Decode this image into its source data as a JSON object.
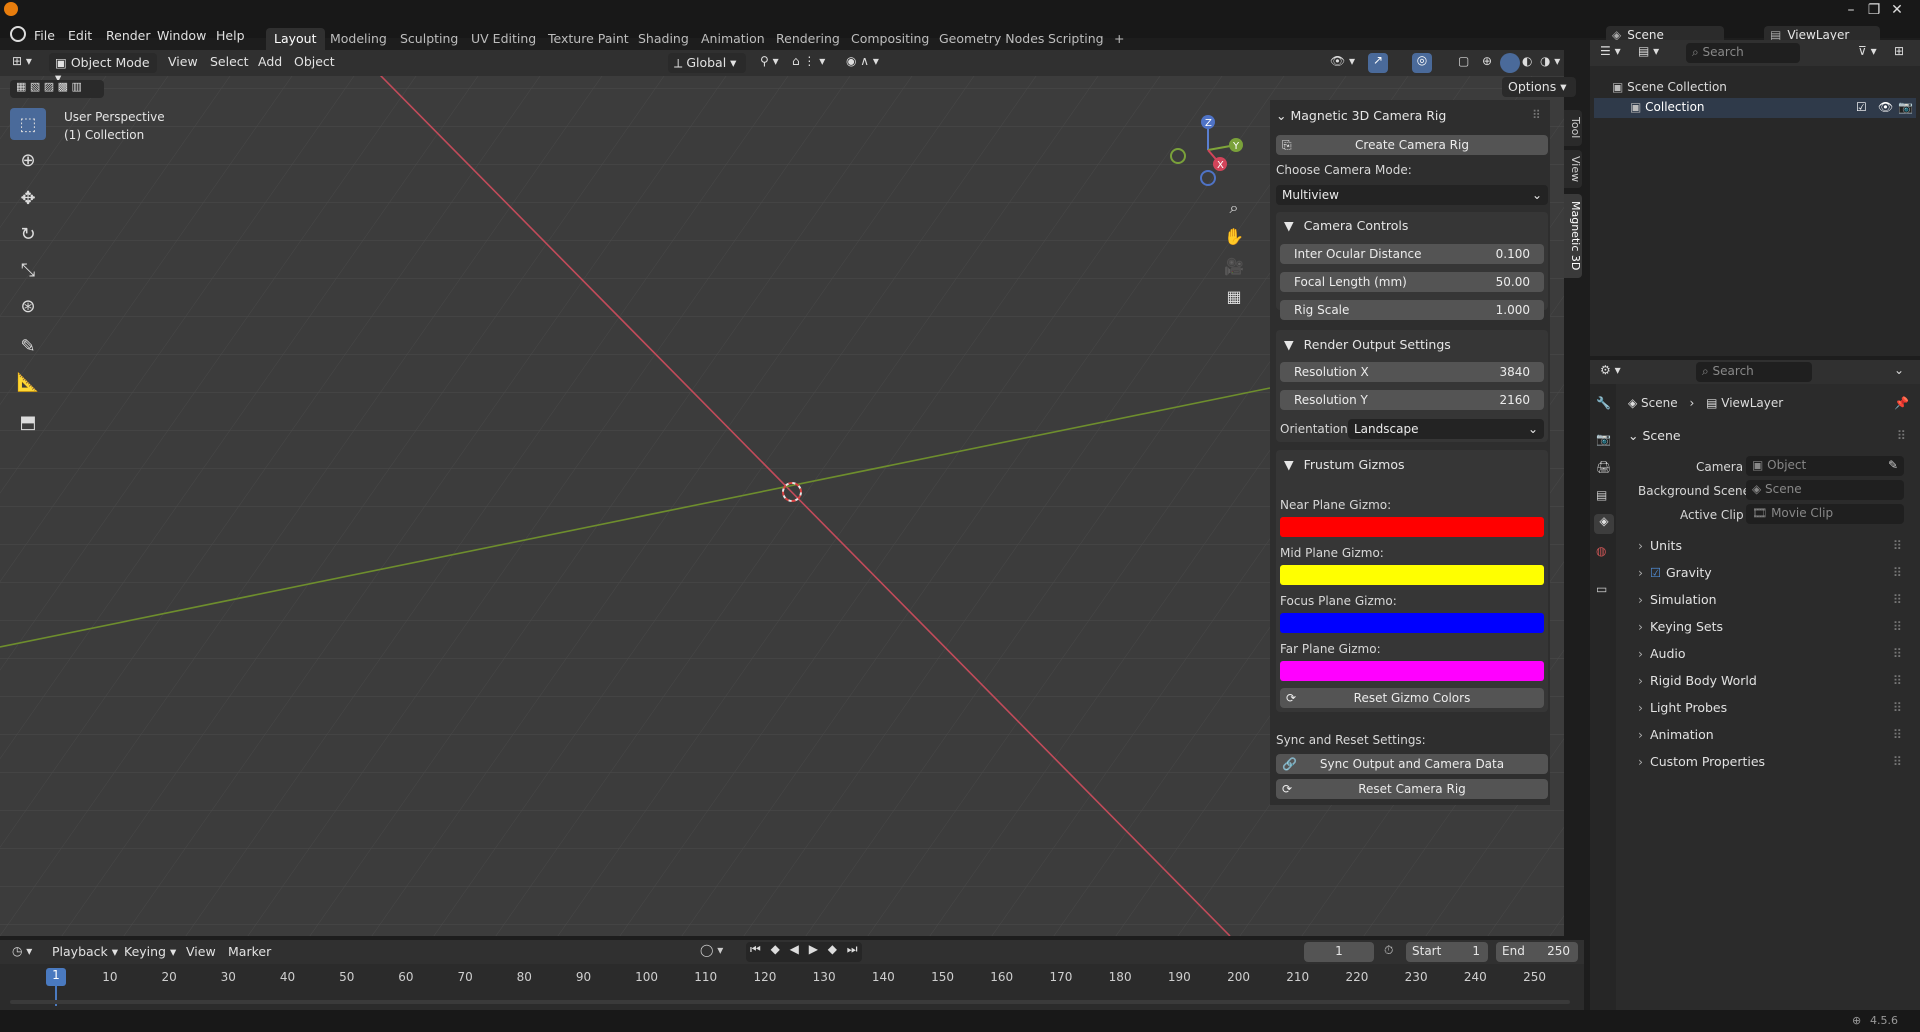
{
  "menubar": {
    "items": [
      "File",
      "Edit",
      "Render",
      "Window",
      "Help"
    ],
    "workspaces": [
      "Layout",
      "Modeling",
      "Sculpting",
      "UV Editing",
      "Texture Paint",
      "Shading",
      "Animation",
      "Rendering",
      "Compositing",
      "Geometry Nodes",
      "Scripting"
    ],
    "add_tab": "+",
    "scene": "Scene",
    "view_layer": "ViewLayer"
  },
  "viewport_header": {
    "mode": "Object Mode",
    "menus": [
      "View",
      "Select",
      "Add",
      "Object"
    ],
    "orientation": "Global",
    "options": "Options"
  },
  "viewport": {
    "perspective": "User Perspective",
    "collection": "(1) Collection",
    "axes": {
      "x": "X",
      "y": "Y",
      "z": "Z"
    }
  },
  "npanel": {
    "title": "Magnetic 3D Camera Rig",
    "create_button": "Create Camera Rig",
    "choose_mode_label": "Choose Camera Mode:",
    "mode_value": "Multiview",
    "camera_controls": {
      "title": "Camera Controls",
      "fields": [
        {
          "label": "Inter Ocular Distance",
          "value": "0.100"
        },
        {
          "label": "Focal Length (mm)",
          "value": "50.00"
        },
        {
          "label": "Rig Scale",
          "value": "1.000"
        }
      ]
    },
    "render_output": {
      "title": "Render Output Settings",
      "fields": [
        {
          "label": "Resolution X",
          "value": "3840"
        },
        {
          "label": "Resolution Y",
          "value": "2160"
        }
      ],
      "orientation_label": "Orientation:",
      "orientation_value": "Landscape"
    },
    "frustum": {
      "title": "Frustum Gizmos",
      "gizmos": [
        {
          "label": "Near Plane Gizmo:",
          "color": "#ff0000"
        },
        {
          "label": "Mid Plane Gizmo:",
          "color": "#ffff00"
        },
        {
          "label": "Focus Plane Gizmo:",
          "color": "#0000ff"
        },
        {
          "label": "Far Plane Gizmo:",
          "color": "#ff00ff"
        }
      ],
      "reset_button": "Reset Gizmo Colors"
    },
    "sync_label": "Sync and Reset Settings:",
    "sync_button": "Sync Output and Camera Data",
    "reset_button": "Reset Camera Rig",
    "tabs": [
      "Tool",
      "View",
      "Magnetic 3D"
    ]
  },
  "outliner": {
    "search_placeholder": "Search",
    "root": "Scene Collection",
    "child": "Collection"
  },
  "properties": {
    "search_placeholder": "Search",
    "breadcrumb_scene": "Scene",
    "breadcrumb_layer": "ViewLayer",
    "section": "Scene",
    "camera_label": "Camera",
    "camera_value": "Object",
    "background_label": "Background Scene",
    "background_value": "Scene",
    "clip_label": "Active Clip",
    "clip_value": "Movie Clip",
    "panels": [
      "Units",
      "Gravity",
      "Simulation",
      "Keying Sets",
      "Audio",
      "Rigid Body World",
      "Light Probes",
      "Animation",
      "Custom Properties"
    ]
  },
  "timeline": {
    "menus": [
      "Playback",
      "Keying",
      "View",
      "Marker"
    ],
    "current_frame": "1",
    "start_label": "Start",
    "start_value": "1",
    "end_label": "End",
    "end_value": "250",
    "ticks": [
      "1",
      "10",
      "20",
      "30",
      "40",
      "50",
      "60",
      "70",
      "80",
      "90",
      "100",
      "110",
      "120",
      "130",
      "140",
      "150",
      "160",
      "170",
      "180",
      "190",
      "200",
      "210",
      "220",
      "230",
      "240",
      "250"
    ]
  },
  "statusbar": {
    "version": "4.5.6"
  }
}
